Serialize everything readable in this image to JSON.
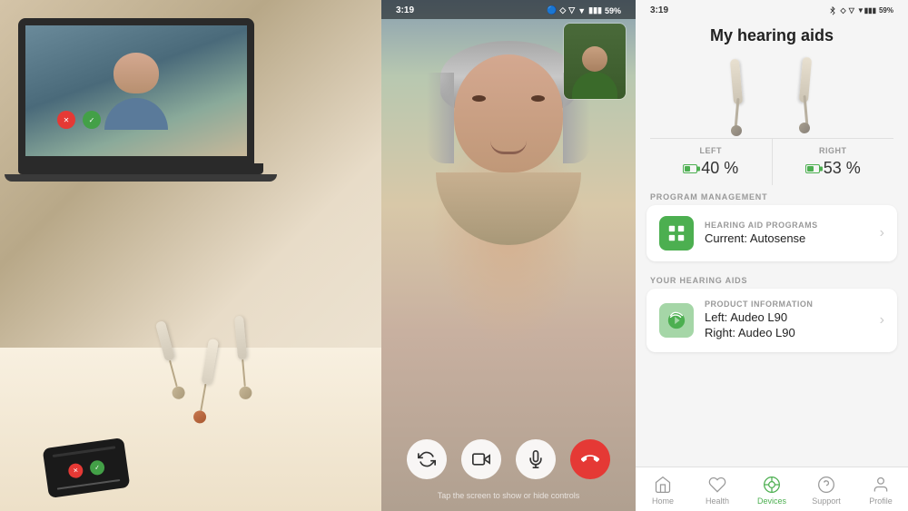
{
  "leftPanel": {
    "altText": "Laptop with video call and hearing aids on table"
  },
  "middlePanel": {
    "statusBar": {
      "time": "3:19",
      "icons": "🔵 ▽ ▼ 📶 59%"
    },
    "hint": "Tap the screen to show or hide controls",
    "controls": [
      {
        "id": "flip-camera",
        "icon": "↻",
        "style": "white"
      },
      {
        "id": "video-toggle",
        "icon": "📷",
        "style": "white"
      },
      {
        "id": "mic-toggle",
        "icon": "🎤",
        "style": "white"
      },
      {
        "id": "end-call",
        "icon": "📞",
        "style": "red"
      }
    ]
  },
  "rightPanel": {
    "statusBar": {
      "time": "3:19",
      "icons": "BT ◇ ▽ 📶 59%"
    },
    "pageTitle": "My hearing aids",
    "battery": {
      "left": {
        "label": "LEFT",
        "value": "40 %",
        "percent": 40
      },
      "right": {
        "label": "RIGHT",
        "value": "53 %",
        "percent": 53
      }
    },
    "sections": [
      {
        "header": "PROGRAM MANAGEMENT",
        "items": [
          {
            "iconType": "grid",
            "iconColor": "green",
            "label": "HEARING AID PROGRAMS",
            "value": "Current: Autosense",
            "hasChevron": true
          }
        ]
      },
      {
        "header": "YOUR HEARING AIDS",
        "items": [
          {
            "iconType": "leaf",
            "iconColor": "light-green",
            "label": "PRODUCT INFORMATION",
            "value": "Left: Audeo L90\nRight: Audeo L90",
            "hasChevron": true
          }
        ]
      }
    ],
    "bottomNav": [
      {
        "id": "home",
        "label": "Home",
        "icon": "house",
        "active": false
      },
      {
        "id": "health",
        "label": "Health",
        "icon": "heart",
        "active": false
      },
      {
        "id": "devices",
        "label": "Devices",
        "icon": "hearing",
        "active": true
      },
      {
        "id": "support",
        "label": "Support",
        "icon": "question",
        "active": false
      },
      {
        "id": "profile",
        "label": "Profile",
        "icon": "person",
        "active": false
      }
    ]
  }
}
